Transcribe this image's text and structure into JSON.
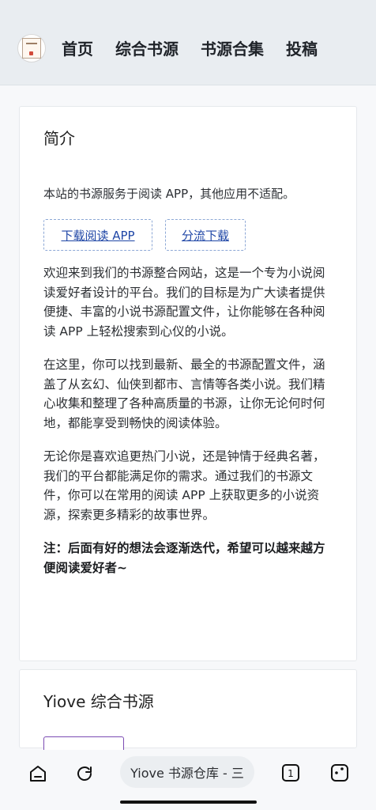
{
  "header": {
    "nav": [
      {
        "label": "首页"
      },
      {
        "label": "综合书源"
      },
      {
        "label": "书源合集"
      },
      {
        "label": "投稿"
      }
    ]
  },
  "intro_card": {
    "title": "简介",
    "lead": "本站的书源服务于阅读 APP，其他应用不适配。",
    "buttons": {
      "download": "下载阅读 APP",
      "split": "分流下载"
    },
    "paragraphs": [
      "欢迎来到我们的书源整合网站，这是一个专为小说阅读爱好者设计的平台。我们的目标是为广大读者提供便捷、丰富的小说书源配置文件，让你能够在各种阅读 APP 上轻松搜索到心仪的小说。",
      "在这里，你可以找到最新、最全的书源配置文件，涵盖了从玄幻、仙侠到都市、言情等各类小说。我们精心收集和整理了各种高质量的书源，让你无论何时何地，都能享受到畅快的阅读体验。",
      "无论你是喜欢追更热门小说，还是钟情于经典名著，我们的平台都能满足你的需求。通过我们的书源文件，你可以在常用的阅读 APP 上获取更多的小说资源，探索更多精彩的故事世界。"
    ],
    "note": "注：后面有好的想法会逐渐迭代，希望可以越来越方便阅读爱好者~"
  },
  "next_card": {
    "title": "Yiove 综合书源"
  },
  "browser": {
    "address": "Yiove 书源仓库 - 三",
    "tab_count": "1"
  },
  "icons": {
    "home": "home-icon",
    "refresh": "refresh-icon",
    "tabs": "tabs-icon",
    "menu": "menu-icon"
  }
}
